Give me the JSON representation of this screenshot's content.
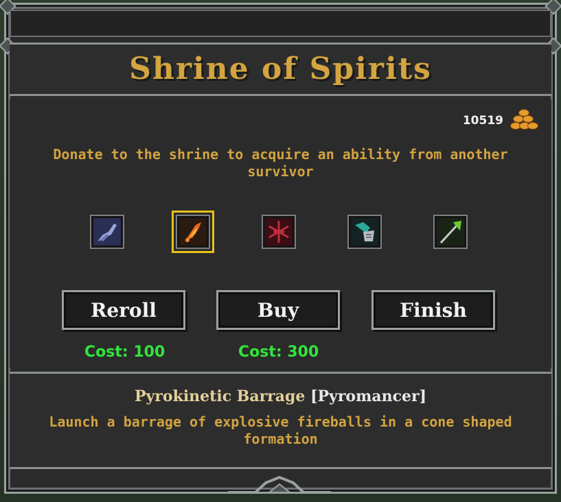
{
  "window": {
    "title": "Shrine of Spirits"
  },
  "gold": {
    "amount": "10519",
    "icon": "coin-pile-icon"
  },
  "shrine": {
    "description": "Donate to the shrine to acquire an ability from another survivor"
  },
  "abilities": [
    {
      "icon": "crescent-blade-icon",
      "selected": false
    },
    {
      "icon": "fireball-icon",
      "selected": true
    },
    {
      "icon": "blood-rune-icon",
      "selected": false
    },
    {
      "icon": "spirit-claw-icon",
      "selected": false
    },
    {
      "icon": "nature-spear-icon",
      "selected": false
    }
  ],
  "buttons": {
    "reroll": "Reroll",
    "buy": "Buy",
    "finish": "Finish"
  },
  "costs": {
    "reroll": "Cost: 100",
    "buy": "Cost: 300"
  },
  "selected_ability": {
    "name": "Pyrokinetic Barrage",
    "class": "[Pyromancer]",
    "description": "Launch a barrage of explosive fireballs in a cone shaped formation"
  },
  "colors": {
    "title_gold": "#d3a440",
    "cost_green": "#33e43c",
    "selection_yellow": "#e8c21a",
    "panel_bg": "#2b2b2b"
  }
}
